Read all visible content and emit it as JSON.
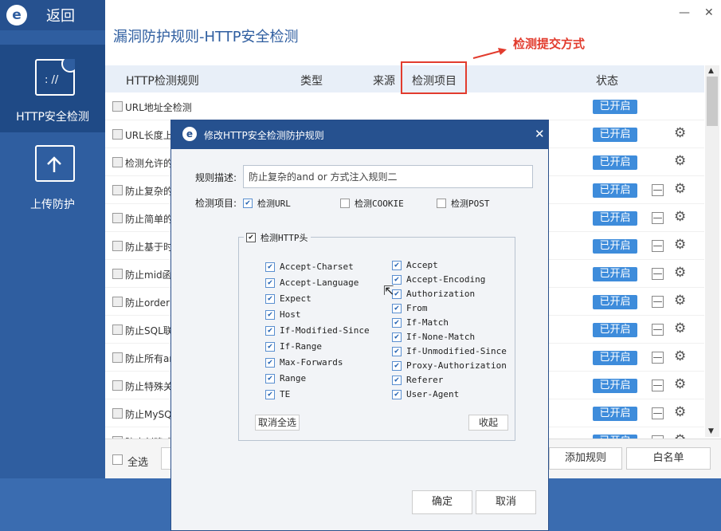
{
  "sidebar": {
    "back": "返回",
    "nav": [
      {
        "label": "HTTP安全检测",
        "icon": "http-icon"
      },
      {
        "label": "上传防护",
        "icon": "upload-icon"
      }
    ]
  },
  "main": {
    "title": "漏洞防护规则-HTTP安全检测",
    "annotation": "检测提交方式",
    "accent": "#e23c2e",
    "columns": [
      "HTTP检测规则",
      "类型",
      "来源",
      "检测项目",
      "状态"
    ],
    "rows": [
      {
        "name": "URL地址全检测",
        "status": "已开启"
      },
      {
        "name": "URL长度上限",
        "status": "已开启"
      },
      {
        "name": "检测允许的H",
        "status": "已开启"
      },
      {
        "name": "防止复杂的a",
        "status": "已开启"
      },
      {
        "name": "防止简单的a",
        "status": "已开启"
      },
      {
        "name": "防止基于时间",
        "status": "已开启"
      },
      {
        "name": "防止mid函数",
        "status": "已开启"
      },
      {
        "name": "防止order b",
        "status": "已开启"
      },
      {
        "name": "防止SQL联合",
        "status": "已开启"
      },
      {
        "name": "防止所有and",
        "status": "已开启"
      },
      {
        "name": "防止特殊关键",
        "status": "已开启"
      },
      {
        "name": "防止MySQL",
        "status": "已开启"
      },
      {
        "name": "防止创建或",
        "status": "已开启"
      }
    ],
    "select_all": "全选",
    "add_rule": "添加规则",
    "whitelist": "白名单"
  },
  "dialog": {
    "title": "修改HTTP安全检测防护规则",
    "desc_label": "规则描述:",
    "desc_value": "防止复杂的and or 方式注入规则二",
    "items_label": "检测项目:",
    "check_url": "检测URL",
    "check_cookie": "检测COOKIE",
    "check_post": "检测POST",
    "header_group": "检测HTTP头",
    "left_headers": [
      "Accept-Charset",
      "Accept-Language",
      "Expect",
      "Host",
      "If-Modified-Since",
      "If-Range",
      "Max-Forwards",
      "Range",
      "TE"
    ],
    "right_headers": [
      "Accept",
      "Accept-Encoding",
      "Authorization",
      "From",
      "If-Match",
      "If-None-Match",
      "If-Unmodified-Since",
      "Proxy-Authorization",
      "Referer",
      "User-Agent"
    ],
    "deselect_all": "取消全选",
    "collapse": "收起",
    "ok": "确定",
    "cancel": "取消"
  }
}
